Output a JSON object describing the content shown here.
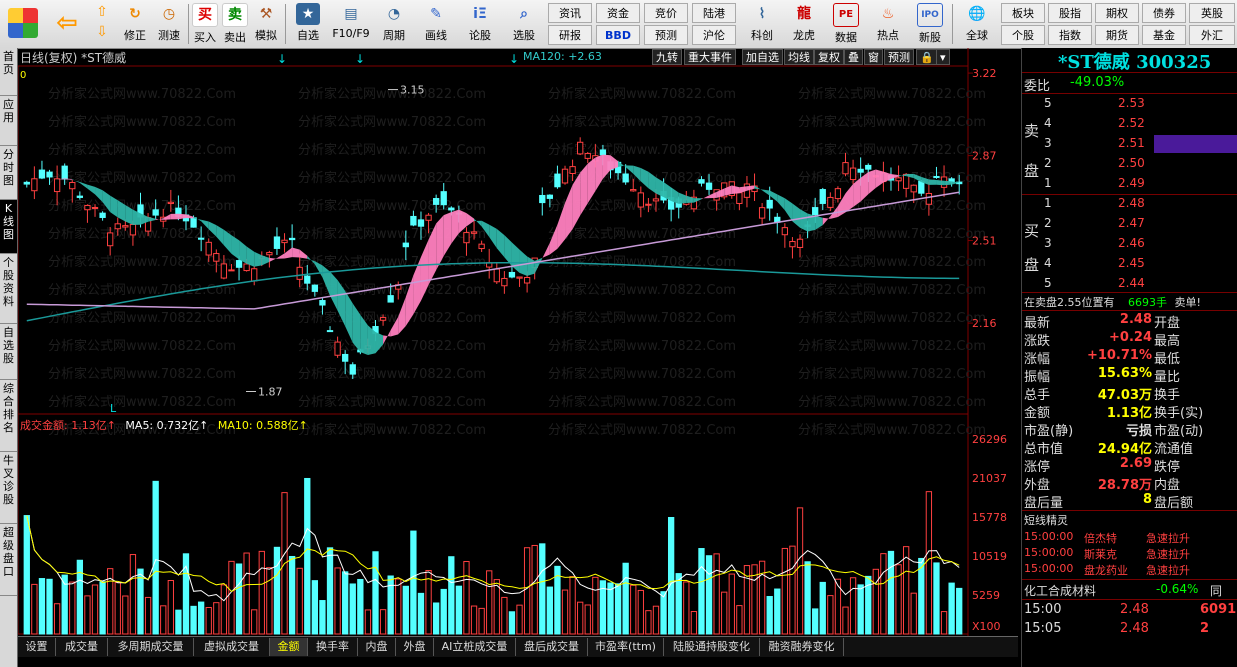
{
  "toolbar": {
    "buttons": [
      {
        "label": "修正",
        "icon": "refresh-icon"
      },
      {
        "label": "测速",
        "icon": "clock-icon"
      },
      {
        "label": "买入",
        "icon": "buy-icon",
        "glyph": "买"
      },
      {
        "label": "卖出",
        "icon": "sell-icon",
        "glyph": "卖"
      },
      {
        "label": "模拟",
        "icon": "hammer-icon"
      },
      {
        "label": "自选",
        "icon": "star-icon"
      },
      {
        "label": "F10/F9",
        "icon": "window-icon"
      },
      {
        "label": "周期",
        "icon": "clock-icon"
      },
      {
        "label": "画线",
        "icon": "pencil-icon"
      },
      {
        "label": "论股",
        "icon": "chat-icon"
      },
      {
        "label": "选股",
        "icon": "search-icon"
      },
      {
        "label": "科创",
        "icon": "chart-icon"
      },
      {
        "label": "龙虎",
        "icon": "dragon-icon"
      },
      {
        "label": "数据",
        "icon": "pe-icon"
      },
      {
        "label": "热点",
        "icon": "fire-icon"
      },
      {
        "label": "新股",
        "icon": "ipo-icon"
      },
      {
        "label": "全球",
        "icon": "globe-icon"
      }
    ],
    "links_row1": [
      "资讯",
      "资金",
      "竞价",
      "陆港"
    ],
    "links_row2": [
      "研报",
      "BBD",
      "预测",
      "沪伦"
    ],
    "links_right_row1": [
      "板块",
      "股指",
      "期权",
      "债券",
      "英股"
    ],
    "links_right_row2": [
      "个股",
      "指数",
      "期货",
      "基金",
      "外汇"
    ]
  },
  "side_tabs": [
    "首页",
    "应用",
    "分时图",
    "K线图",
    "个股资料",
    "自选股",
    "综合排名",
    "牛叉诊股",
    "超级盘口"
  ],
  "chart": {
    "title": "日线(复权) *ST德威",
    "ma120": "MA120: +2.63",
    "tools": [
      "九转",
      "重大事件",
      "加自选",
      "均线",
      "复权",
      "叠",
      "窗",
      "预测"
    ],
    "high_label": "3.15",
    "low_label": "1.87",
    "l_marker": "L",
    "zero_label": "0",
    "price_axis": [
      "3.22",
      "2.87",
      "2.51",
      "2.16"
    ],
    "volume_axis": [
      "26296",
      "21037",
      "15778",
      "10519",
      "5259",
      "X100"
    ],
    "vol_header": {
      "amount": "成交金额: 1.13亿↑",
      "ma5": "MA5: 0.732亿↑",
      "ma10": "MA10: 0.588亿↑"
    },
    "watermark": "分析家公式网www.70822.Com"
  },
  "bottom_tabs": [
    "设置",
    "成交量",
    "多周期成交量",
    "虚拟成交量",
    "金额",
    "换手率",
    "内盘",
    "外盘",
    "AI立桩成交量",
    "盘后成交量",
    "市盈率(ttm)",
    "陆股通持股变化",
    "融资融券变化"
  ],
  "active_bottom_tab": "金额",
  "quote": {
    "name": "*ST德威",
    "code": "300325",
    "webi_label": "委比",
    "webi": "-49.03%",
    "sell_label": [
      "卖",
      "盘"
    ],
    "buy_label": [
      "买",
      "盘"
    ],
    "asks": [
      {
        "n": "5",
        "p": "2.53"
      },
      {
        "n": "4",
        "p": "2.52"
      },
      {
        "n": "3",
        "p": "2.51"
      },
      {
        "n": "2",
        "p": "2.50"
      },
      {
        "n": "1",
        "p": "2.49"
      }
    ],
    "bids": [
      {
        "n": "1",
        "p": "2.48"
      },
      {
        "n": "2",
        "p": "2.47"
      },
      {
        "n": "3",
        "p": "2.46"
      },
      {
        "n": "4",
        "p": "2.45"
      },
      {
        "n": "5",
        "p": "2.44"
      }
    ],
    "notice_text": "在卖盘2.55位置有",
    "notice_qty": "6693手",
    "notice_tag": "卖单!",
    "stats": [
      {
        "l": "最新",
        "v": "2.48",
        "c": "red",
        "r": "开盘"
      },
      {
        "l": "涨跌",
        "v": "+0.24",
        "c": "red",
        "r": "最高"
      },
      {
        "l": "涨幅",
        "v": "+10.71%",
        "c": "red",
        "r": "最低"
      },
      {
        "l": "振幅",
        "v": "15.63%",
        "c": "yellow",
        "r": "量比"
      },
      {
        "l": "总手",
        "v": "47.03万",
        "c": "yellow",
        "r": "换手"
      },
      {
        "l": "金额",
        "v": "1.13亿",
        "c": "yellow",
        "r": "换手(实)"
      },
      {
        "l": "市盈(静)",
        "v": "亏损",
        "c": "lbl",
        "r": "市盈(动)"
      },
      {
        "l": "总市值",
        "v": "24.94亿",
        "c": "yellow",
        "r": "流通值"
      },
      {
        "l": "涨停",
        "v": "2.69",
        "c": "red",
        "r": "跌停"
      },
      {
        "l": "外盘",
        "v": "28.78万",
        "c": "red",
        "r": "内盘"
      },
      {
        "l": "盘后量",
        "v": "8",
        "c": "yellow",
        "r": "盘后额"
      }
    ],
    "short_title": "短线精灵",
    "short_items": [
      {
        "t": "15:00:00",
        "n": "倍杰特",
        "e": "急速拉升"
      },
      {
        "t": "15:00:00",
        "n": "斯莱克",
        "e": "急速拉升"
      },
      {
        "t": "15:00:00",
        "n": "盘龙药业",
        "e": "急速拉升"
      }
    ],
    "sector_name": "化工合成材料",
    "sector_pct": "-0.64%",
    "sector_extra": "同",
    "ticks": [
      {
        "t": "15:00",
        "p": "2.48",
        "v": "6091"
      },
      {
        "t": "15:05",
        "p": "2.48",
        "v": "2"
      }
    ]
  },
  "colors": {
    "up": "#ff4040",
    "down": "#54ffff",
    "bg": "#000000",
    "ma_teal": "#1a9999",
    "ma_purple": "#c79ad7"
  }
}
